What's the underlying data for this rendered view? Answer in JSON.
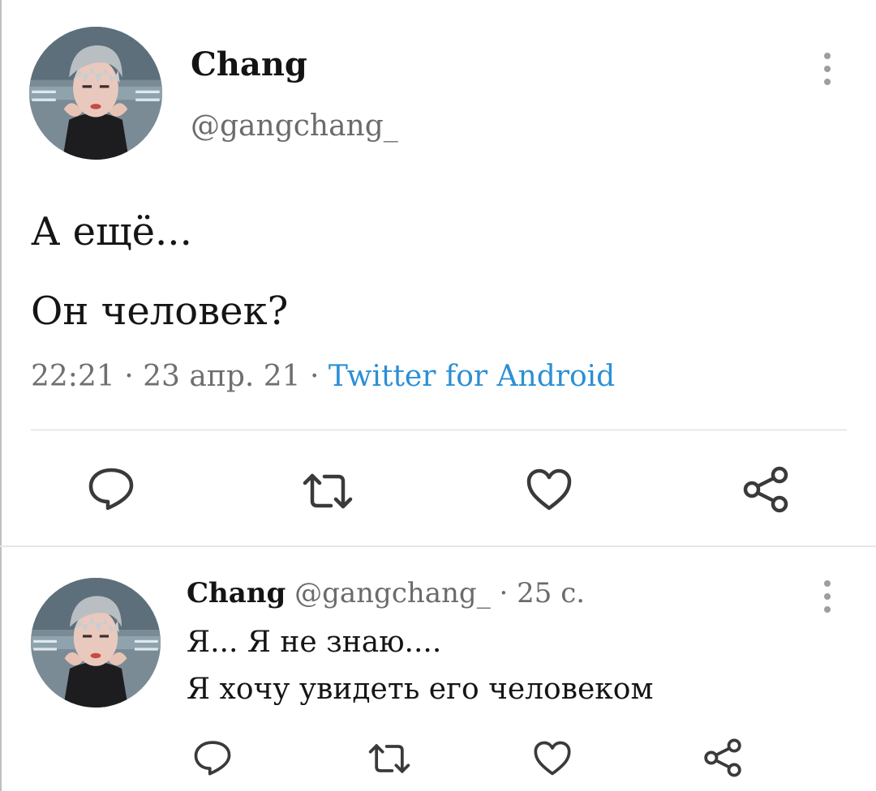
{
  "tweet": {
    "author_name": "Chang",
    "author_handle": "@gangchang_",
    "text_line1": "А ещё...",
    "text_line2": "Он человек?",
    "time": "22:21",
    "date": "23 апр. 21",
    "separator": "·",
    "source": "Twitter for Android",
    "actions": [
      "reply-icon",
      "retweet-icon",
      "like-icon",
      "share-icon"
    ]
  },
  "reply": {
    "author_name": "Chang",
    "author_handle": "@gangchang_",
    "separator": "·",
    "time_ago": "25 с.",
    "text_line1": "Я... Я не знаю....",
    "text_line2": "Я хочу увидеть его человеком",
    "actions": [
      "reply-icon",
      "retweet-icon",
      "like-icon",
      "share-icon"
    ]
  },
  "colors": {
    "link": "#2b8fd6",
    "secondary_text": "#6f6f6f",
    "icon": "#3a3a3a"
  }
}
